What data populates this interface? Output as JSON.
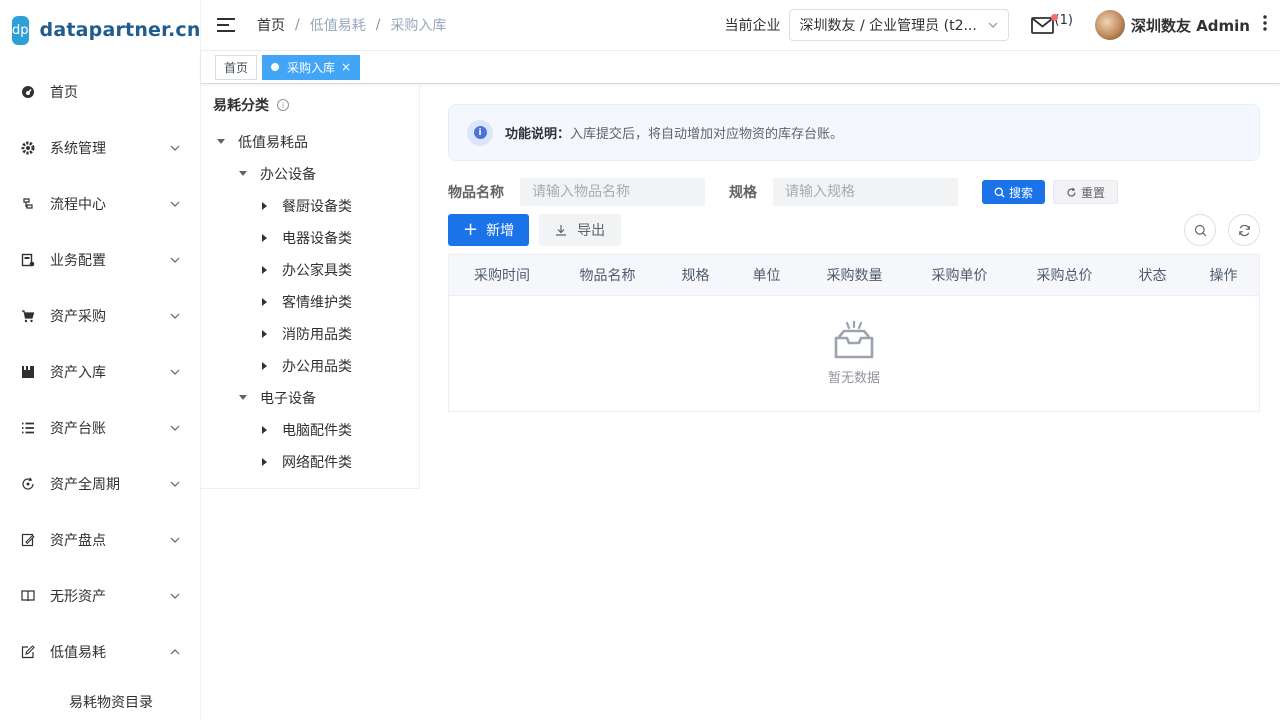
{
  "logo": {
    "mark": "dp",
    "text": "datapartner.cn"
  },
  "sidebar": {
    "items": [
      {
        "label": "首页",
        "icon": "dashboard-icon",
        "chevron": ""
      },
      {
        "label": "系统管理",
        "icon": "gear-icon",
        "chevron": "down"
      },
      {
        "label": "流程中心",
        "icon": "flow-icon",
        "chevron": "down"
      },
      {
        "label": "业务配置",
        "icon": "config-icon",
        "chevron": "down"
      },
      {
        "label": "资产采购",
        "icon": "cart-icon",
        "chevron": "down"
      },
      {
        "label": "资产入库",
        "icon": "storage-icon",
        "chevron": "down"
      },
      {
        "label": "资产台账",
        "icon": "list-icon",
        "chevron": "down"
      },
      {
        "label": "资产全周期",
        "icon": "cycle-icon",
        "chevron": "down"
      },
      {
        "label": "资产盘点",
        "icon": "inventory-icon",
        "chevron": "down"
      },
      {
        "label": "无形资产",
        "icon": "book-icon",
        "chevron": "down"
      },
      {
        "label": "低值易耗",
        "icon": "edit-icon",
        "chevron": "up"
      }
    ],
    "sub_items": [
      "易耗物资目录"
    ]
  },
  "header": {
    "breadcrumb": [
      "首页",
      "低值易耗",
      "采购入库"
    ],
    "company_label": "当前企业",
    "company_value": "深圳数友 / 企业管理员 (t2...",
    "mail_count": "(1)",
    "user_name": "深圳数友 Admin"
  },
  "tags": [
    {
      "label": "首页",
      "active": false
    },
    {
      "label": "采购入库",
      "active": true
    }
  ],
  "tree": {
    "title": "易耗分类",
    "nodes": [
      {
        "label": "低值易耗品",
        "level": 0,
        "expanded": true
      },
      {
        "label": "办公设备",
        "level": 1,
        "expanded": true
      },
      {
        "label": "餐厨设备类",
        "level": 2,
        "expanded": false
      },
      {
        "label": "电器设备类",
        "level": 2,
        "expanded": false
      },
      {
        "label": "办公家具类",
        "level": 2,
        "expanded": false
      },
      {
        "label": "客情维护类",
        "level": 2,
        "expanded": false
      },
      {
        "label": "消防用品类",
        "level": 2,
        "expanded": false
      },
      {
        "label": "办公用品类",
        "level": 2,
        "expanded": false
      },
      {
        "label": "电子设备",
        "level": 1,
        "expanded": true
      },
      {
        "label": "电脑配件类",
        "level": 2,
        "expanded": false
      },
      {
        "label": "网络配件类",
        "level": 2,
        "expanded": false
      }
    ]
  },
  "alert": {
    "title": "功能说明：",
    "text": "入库提交后，将自动增加对应物资的库存台账。"
  },
  "search": {
    "name_label": "物品名称",
    "name_placeholder": "请输入物品名称",
    "spec_label": "规格",
    "spec_placeholder": "请输入规格",
    "search_label": "搜索",
    "reset_label": "重置"
  },
  "toolbar": {
    "add_label": "新增",
    "export_label": "导出"
  },
  "table": {
    "columns": [
      "采购时间",
      "物品名称",
      "规格",
      "单位",
      "采购数量",
      "采购单价",
      "采购总价",
      "状态",
      "操作"
    ],
    "empty_text": "暂无数据"
  },
  "colors": {
    "primary": "#1a73e8",
    "tag_active": "#42a5f5",
    "logo_bg": "#2f9fd8",
    "logo_text": "#1f5c8f"
  }
}
